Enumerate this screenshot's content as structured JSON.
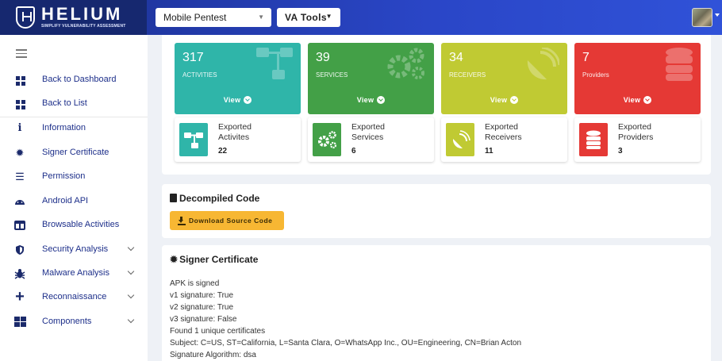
{
  "brand": {
    "name": "HELIUM",
    "tagline": "SIMPLIFY VULNERABILITY ASSESSMENT"
  },
  "header": {
    "project_select": {
      "value": "Mobile Pentest"
    },
    "tools_button": {
      "label": "VA Tools"
    }
  },
  "sidebar": {
    "items": [
      {
        "label": "Back to Dashboard",
        "icon": "dashboard-icon"
      },
      {
        "label": "Back to List",
        "icon": "list-grid-icon"
      },
      {
        "label": "Information",
        "icon": "info-icon"
      },
      {
        "label": "Signer Certificate",
        "icon": "certificate-icon"
      },
      {
        "label": "Permission",
        "icon": "permission-list-icon"
      },
      {
        "label": "Android API",
        "icon": "android-icon"
      },
      {
        "label": "Browsable Activities",
        "icon": "browser-window-icon"
      },
      {
        "label": "Security Analysis",
        "icon": "shield-icon",
        "expandable": true
      },
      {
        "label": "Malware Analysis",
        "icon": "bug-icon",
        "expandable": true
      },
      {
        "label": "Reconnaissance",
        "icon": "plus-icon",
        "expandable": true
      },
      {
        "label": "Components",
        "icon": "components-grid-icon",
        "expandable": true
      }
    ]
  },
  "stats": [
    {
      "count": "317",
      "caption": "ACTIVITIES",
      "view_label": "View",
      "color": "#2fb5a9",
      "exported_label": "Exported",
      "exported_kind": "Activites",
      "exported_count": "22",
      "icon": "sitemap-icon"
    },
    {
      "count": "39",
      "caption": "SERVICES",
      "view_label": "View",
      "color": "#43a047",
      "exported_label": "Exported",
      "exported_kind": "Services",
      "exported_count": "6",
      "icon": "cogs-icon"
    },
    {
      "count": "34",
      "caption": "RECEIVERS",
      "view_label": "View",
      "color": "#c0ca33",
      "exported_label": "Exported",
      "exported_kind": "Receivers",
      "exported_count": "11",
      "icon": "satellite-dish-icon"
    },
    {
      "count": "7",
      "caption": "Providers",
      "view_label": "View",
      "color": "#e53935",
      "exported_label": "Exported",
      "exported_kind": "Providers",
      "exported_count": "3",
      "icon": "database-icon"
    }
  ],
  "decompiled": {
    "title": "Decompiled Code",
    "download_label": "Download Source Code"
  },
  "signer": {
    "title": "Signer Certificate",
    "lines": [
      "APK is signed",
      "v1 signature: True",
      "v2 signature: True",
      "v3 signature: False",
      "Found 1 unique certificates",
      "Subject: C=US, ST=California, L=Santa Clara, O=WhatsApp Inc., OU=Engineering, CN=Brian Acton",
      "Signature Algorithm: dsa"
    ]
  }
}
